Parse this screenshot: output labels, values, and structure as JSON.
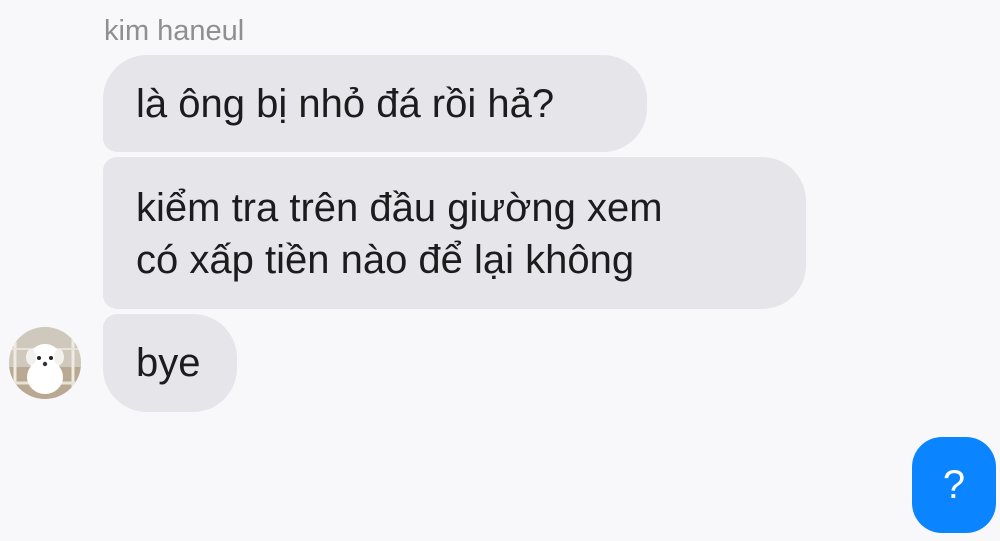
{
  "chat": {
    "sender_name": "kim haneul",
    "messages": [
      {
        "text": "là ông bị nhỏ đá rồi hả?"
      },
      {
        "line1": "kiểm tra trên đầu giường xem",
        "line2": "có xấp tiền nào để lại không"
      },
      {
        "text": "bye"
      }
    ],
    "avatar": "white-dog-avatar"
  },
  "help_button": {
    "label": "?",
    "color": "#0a84ff"
  },
  "colors": {
    "background": "#f8f8fa",
    "bubble": "#e5e5ea",
    "sender_name": "#8e8e93"
  }
}
